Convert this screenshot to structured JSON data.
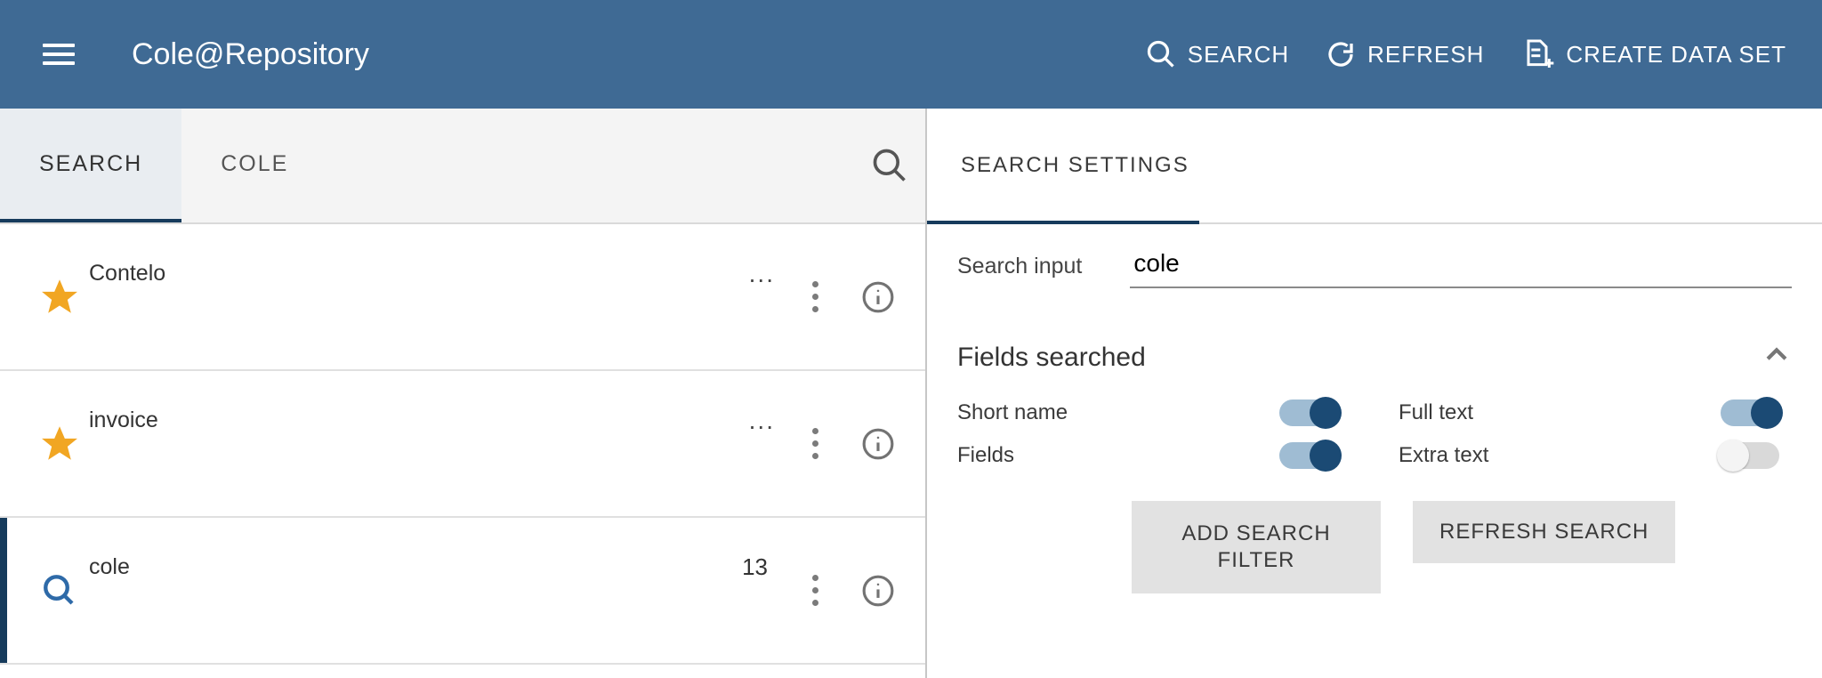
{
  "appbar": {
    "title": "Cole@Repository",
    "actions": {
      "search": "SEARCH",
      "refresh": "REFRESH",
      "create": "CREATE DATA SET"
    }
  },
  "tabs": [
    {
      "id": "search",
      "label": "SEARCH",
      "active": true
    },
    {
      "id": "cole",
      "label": "COLE",
      "active": false
    }
  ],
  "results": [
    {
      "icon": "star",
      "title": "Contelo",
      "trail": "dots",
      "count": null,
      "selected": false
    },
    {
      "icon": "star",
      "title": "invoice",
      "trail": "dots",
      "count": null,
      "selected": false
    },
    {
      "icon": "search",
      "title": "cole",
      "trail": "count",
      "count": "13",
      "selected": true
    }
  ],
  "settings": {
    "title": "SEARCH SETTINGS",
    "search_input_label": "Search input",
    "search_input_value": "cole",
    "fields_searched_label": "Fields searched",
    "switches": {
      "short_name": {
        "label": "Short name",
        "on": true
      },
      "full_text": {
        "label": "Full text",
        "on": true
      },
      "fields": {
        "label": "Fields",
        "on": true
      },
      "extra_text": {
        "label": "Extra text",
        "on": false
      }
    },
    "buttons": {
      "add_filter": "ADD SEARCH FILTER",
      "refresh_search": "REFRESH SEARCH"
    }
  }
}
